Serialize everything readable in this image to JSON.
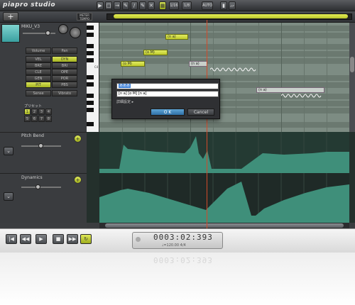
{
  "app": {
    "logo": "piapro studio"
  },
  "toolbar": {
    "meter_tempo": "METER TEMPO",
    "quantize": "1/16",
    "length": "1/8",
    "auto": "AUTO"
  },
  "track": {
    "name": "MIKU_V3",
    "volume_tab": "Volume",
    "pan_tab": "Pan",
    "params": [
      [
        "VEL",
        "DYN"
      ],
      [
        "BRE",
        "BRI"
      ],
      [
        "CLE",
        "OPE"
      ],
      [
        "GEN",
        "POR"
      ],
      [
        "PIT",
        "PBS"
      ]
    ],
    "sense": "Sense",
    "vibrato": "Vibrato",
    "preset_label": "プリセット",
    "presets": [
      "1",
      "2",
      "3",
      "4",
      "5",
      "6",
      "7",
      "8"
    ]
  },
  "piano": {
    "c4_label": "C4"
  },
  "notes": [
    {
      "lyric": "(n a)"
    },
    {
      "lyric": "(o M)"
    },
    {
      "lyric": "(o M)"
    },
    {
      "lyric": "(n a)"
    },
    {
      "lyric": "(n a)"
    }
  ],
  "lanes": {
    "pitch_bend": "Pitch Bend",
    "dynamics": "Dynamics"
  },
  "dialog": {
    "lyric_value": "あああ",
    "phoneme_value": "[n a] [o M] [n a]",
    "detail_label": "詳細設定",
    "ok_label": "O K",
    "cancel_label": "Cancel"
  },
  "transport": {
    "timecode": "0003:02:393",
    "tempo": "♩=120.00  4/4"
  },
  "colors": {
    "accent": "#c8d436",
    "playhead": "#d34a2a",
    "pitch_fill": "#3f8f7a"
  }
}
